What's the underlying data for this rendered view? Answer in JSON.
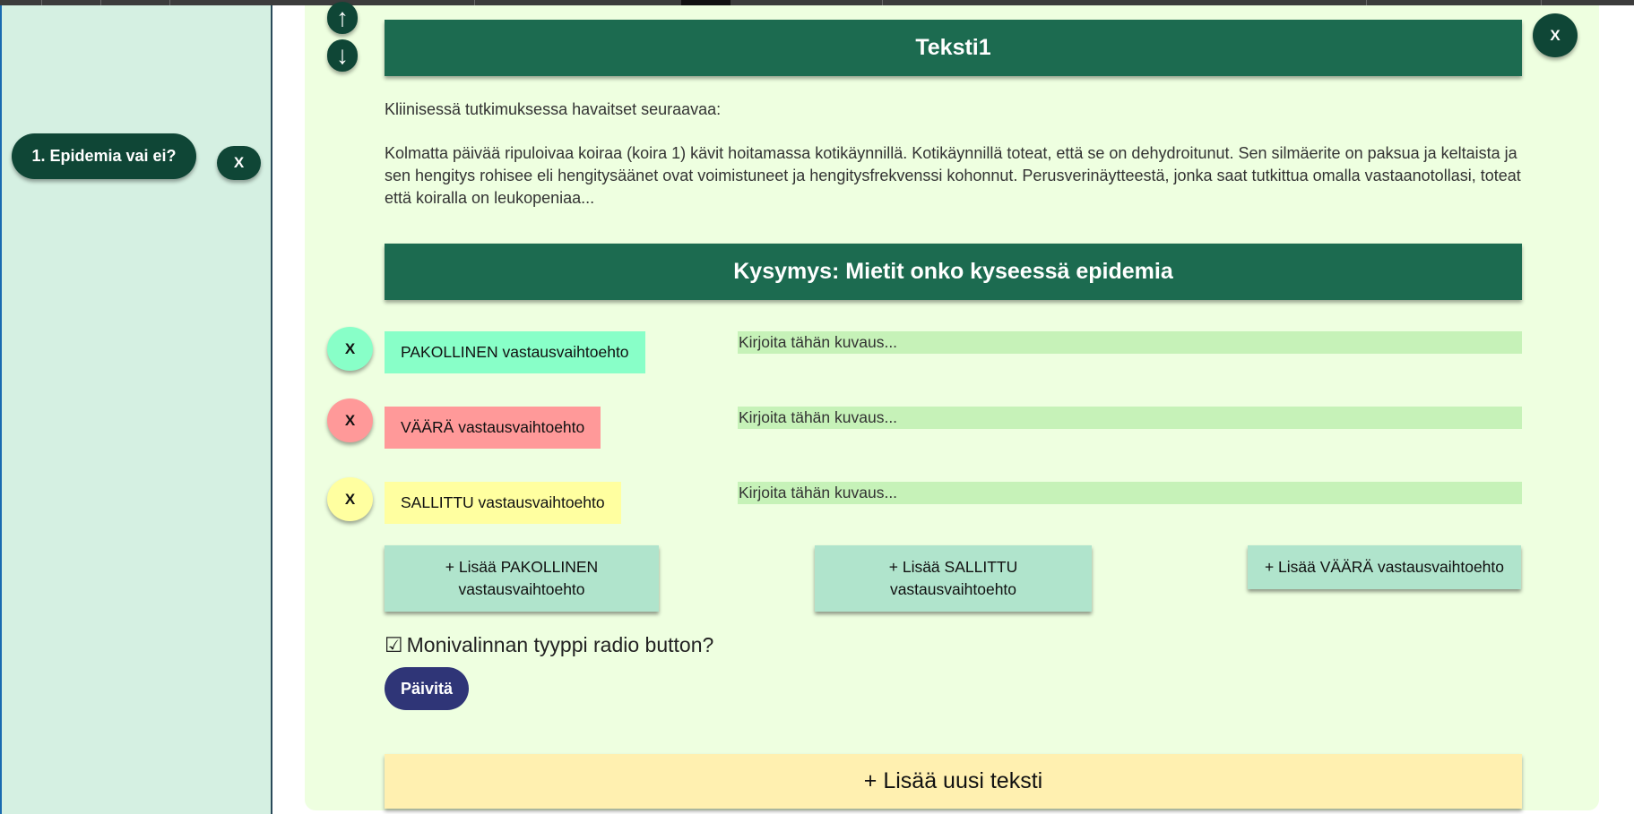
{
  "sidebar": {
    "scenario_label": "1. Epidemia vai ei?",
    "delete_label": "X"
  },
  "editor": {
    "move_up_label": "↑",
    "move_down_label": "↓",
    "delete_block_label": "X",
    "text_block": {
      "title": "Teksti1",
      "paragraphs": [
        "Kliinisessä tutkimuksessa havaitset seuraavaa:",
        "Kolmatta päivää ripuloivaa koiraa (koira 1) kävit hoitamassa kotikäynnillä. Kotikäynnillä toteat, että se on dehydroitunut. Sen silmäerite on paksua ja keltaista ja sen hengitys rohisee eli hengitysäänet ovat voimistuneet ja hengitysfrekvenssi kohonnut. Perusverinäytteestä, jonka saat tutkittua omalla vastaanotollasi, toteat että koiralla on leukopeniaa..."
      ]
    },
    "question_title": "Kysymys: Mietit onko kyseessä epidemia",
    "options": [
      {
        "delete_label": "X",
        "label": "PAKOLLINEN vastausvaihtoehto",
        "placeholder": "Kirjoita tähän kuvaus...",
        "color": "#88ffc8"
      },
      {
        "delete_label": "X",
        "label": "VÄÄRÄ vastausvaihtoehto",
        "placeholder": "Kirjoita tähän kuvaus...",
        "color": "#ff9999"
      },
      {
        "delete_label": "X",
        "label": "SALLITTU vastausvaihtoehto",
        "placeholder": "Kirjoita tähän kuvaus...",
        "color": "#ffffa0"
      }
    ],
    "add_buttons": {
      "required": "+ Lisää PAKOLLINEN vastausvaihtoehto",
      "allowed": "+ Lisää SALLITTU vastausvaihtoehto",
      "wrong": "+ Lisää VÄÄRÄ vastausvaihtoehto"
    },
    "radio_checkbox": {
      "checked_symbol": "☑",
      "label": "Monivalinnan tyyppi radio button?"
    },
    "update_label": "Päivitä",
    "add_text_label": "+ Lisää uusi teksti"
  },
  "colors": {
    "sidebar_bg": "#d5f0e2",
    "panel_bg": "#eeffe0",
    "header_bg": "#1c6b50",
    "dark_button": "#0f4636",
    "update_button": "#2f3577",
    "add_button_bg": "#b0e4cc",
    "add_text_bg": "#fff0b0",
    "input_bg": "#c6f2b8"
  }
}
